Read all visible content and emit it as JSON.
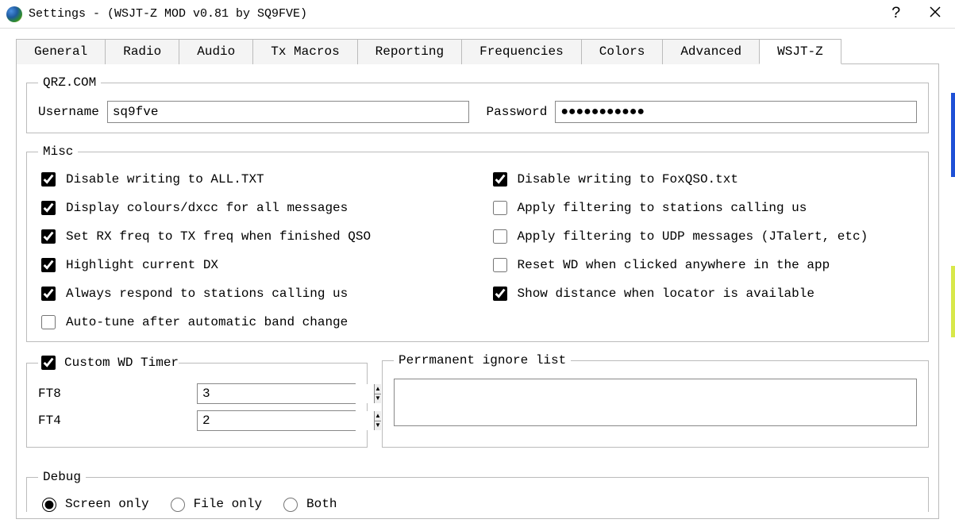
{
  "window_title": "Settings - (WSJT-Z MOD v0.81 by SQ9FVE)",
  "tabs": [
    "General",
    "Radio",
    "Audio",
    "Tx Macros",
    "Reporting",
    "Frequencies",
    "Colors",
    "Advanced",
    "WSJT-Z"
  ],
  "active_tab": "WSJT-Z",
  "qrz": {
    "legend": "QRZ.COM",
    "username_label": "Username",
    "username_value": "sq9fve",
    "password_label": "Password",
    "password_value": "●●●●●●●●●●●"
  },
  "misc": {
    "legend": "Misc",
    "left": [
      {
        "label": "Disable writing to ALL.TXT",
        "checked": true
      },
      {
        "label": "Display colours/dxcc for all messages",
        "checked": true
      },
      {
        "label": "Set RX freq to TX freq when finished QSO",
        "checked": true
      },
      {
        "label": "Highlight current DX",
        "checked": true
      },
      {
        "label": "Always respond to stations calling us",
        "checked": true
      },
      {
        "label": "Auto-tune after automatic band change",
        "checked": false
      }
    ],
    "right": [
      {
        "label": "Disable writing to FoxQSO.txt",
        "checked": true
      },
      {
        "label": "Apply filtering to stations calling us",
        "checked": false
      },
      {
        "label": "Apply filtering to UDP messages (JTalert, etc)",
        "checked": false
      },
      {
        "label": "Reset WD when clicked anywhere in the app",
        "checked": false
      },
      {
        "label": "Show distance when locator is available",
        "checked": true
      }
    ]
  },
  "wd": {
    "legend_label": "Custom WD Timer",
    "legend_checked": true,
    "ft8_label": "FT8",
    "ft8_value": "3",
    "ft4_label": "FT4",
    "ft4_value": "2"
  },
  "ignore": {
    "legend": "Perrmanent ignore list",
    "value": ""
  },
  "debug": {
    "legend": "Debug",
    "options": [
      "Screen only",
      "File only",
      "Both"
    ],
    "selected": "Screen only"
  }
}
